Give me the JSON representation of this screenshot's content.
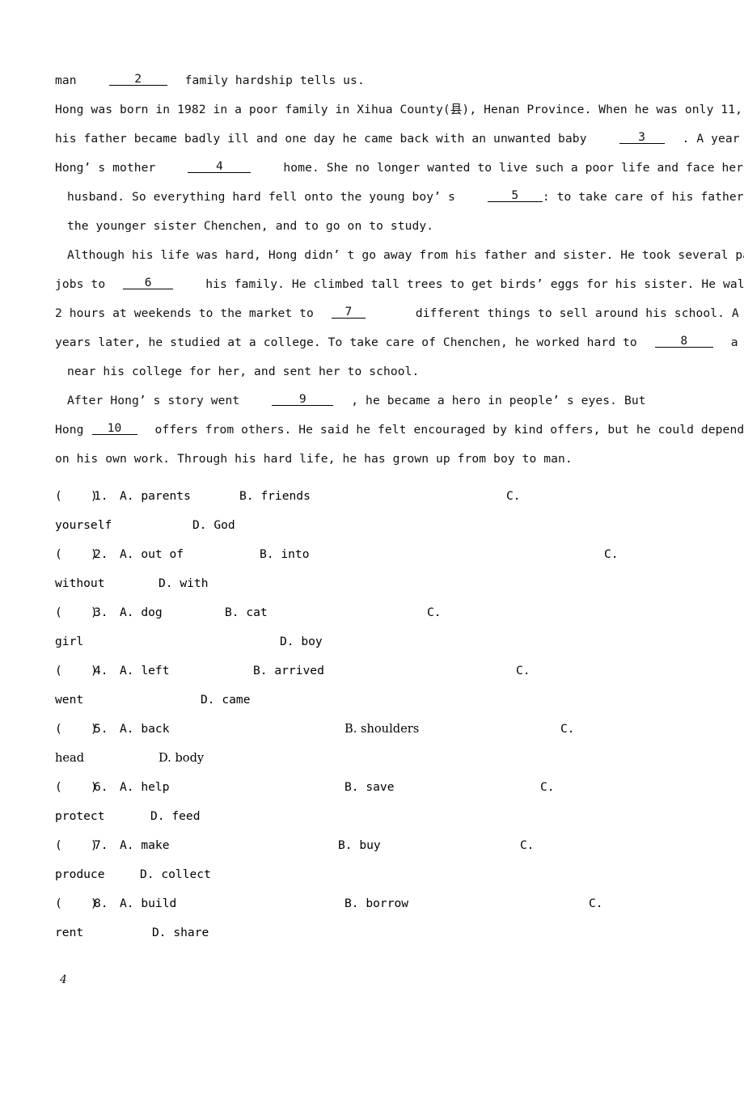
{
  "document": {
    "page_number": "4",
    "language": "en",
    "type": "cloze-test-worksheet"
  },
  "passage": {
    "lines": [
      {
        "id": "l1",
        "segments": [
          "man",
          "blank:2",
          "family hardship tells us."
        ]
      },
      {
        "id": "l2",
        "text": "Hong was born in  1982 in  a poor family in Xihua County(县), Henan Province. When he was only 11,"
      },
      {
        "id": "l3",
        "segments": [
          "his father became badly ill and one day he came back with an unwanted baby",
          "blank:3",
          ". A year later,"
        ]
      },
      {
        "id": "l4",
        "segments": [
          "Hong’ s mother",
          "blank:4",
          "home. She no longer wanted to live such a poor life and face her sick"
        ]
      },
      {
        "id": "l5",
        "segments": [
          "husband. So everything hard fell onto the young boy’ s",
          "blank:5",
          ": to take care of his father and"
        ]
      },
      {
        "id": "l6",
        "text": "the younger sister Chenchen, and to go on to study."
      },
      {
        "id": "l7",
        "text": "Although his life was hard, Hong didn’ t go away from his father and sister. He took several part-time"
      },
      {
        "id": "l8",
        "segments": [
          "jobs to",
          "blank:6",
          "his family. He climbed tall trees to get birds’ eggs for his sister. He walked"
        ]
      },
      {
        "id": "l9",
        "segments": [
          "2 hours at weekends to the market to",
          "blank:7",
          "different things to sell around his school. A few"
        ]
      },
      {
        "id": "l10",
        "segments": [
          "years later, he studied at a college. To take care of Chenchen, he worked hard to",
          "blank:8",
          "a  room"
        ]
      },
      {
        "id": "l11",
        "text": "near his college for her, and sent her to school."
      },
      {
        "id": "l12",
        "segments": [
          "After Hong’ s story went",
          "blank:9",
          ", he became a hero in people’ s eyes. But"
        ]
      },
      {
        "id": "l13",
        "segments": [
          "Hong",
          "blank:10",
          "offers from others. He said he felt encouraged by kind offers, but he could depend"
        ]
      },
      {
        "id": "l14",
        "text": "on his own work. Through his hard life, he has grown up from boy to man."
      }
    ],
    "text_l1_pre": "man",
    "text_l1_post": "family hardship tells us.",
    "text_l2": "Hong was born in  1982 in  a poor family in Xihua County(县), Henan Province. When he was only 11,",
    "text_l3_pre": "his father became badly ill and one day he came back with an unwanted baby",
    "text_l3_post": ". A year later,",
    "text_l4_pre": "Hong’ s mother",
    "text_l4_post": "home. She no longer wanted to live such a poor life and face her sick",
    "text_l5_pre": "husband. So everything hard fell onto the young boy’ s",
    "text_l5_post": ": to take care of his father and",
    "text_l6": "the younger sister Chenchen,  and to go on to study.",
    "text_l7": "Although his life was hard, Hong didn’ t go away from his father and sister. He took several part-time",
    "text_l8_pre": "jobs to",
    "text_l8_post": "his family. He climbed tall trees to get birds’ eggs for his sister. He walked",
    "text_l9_pre": "2 hours at weekends to the market to",
    "text_l9_post": "different things to sell around his school. A few",
    "text_l10_pre": "years later, he studied at a college. To take care of Chenchen, he worked hard to",
    "text_l10_post": "a  room",
    "text_l11": "near his college for her, and sent her to school.",
    "text_l12_pre": "After Hong’ s story went",
    "text_l12_post": ", he became a hero in people’ s eyes. But",
    "text_l13_pre": "Hong",
    "text_l13_post": "offers from others. He said he felt encouraged by kind offers, but he could depend",
    "text_l14": "on his own work. Through his hard life, he has grown up from boy to man."
  },
  "blanks": {
    "n2": "2",
    "n3": "3",
    "n4": "4",
    "n5": "5",
    "n6": "6",
    "n7": "7",
    "n8": "8",
    "n9": "9",
    "n10": "10"
  },
  "questions": [
    {
      "number": "1",
      "bracket": "(    )",
      "num_label": "1.",
      "a": "A. parents",
      "b": "B. friends",
      "c_marker": "C.",
      "c_text": "yourself",
      "d": "D. God"
    },
    {
      "number": "2",
      "bracket": "(    )",
      "num_label": "2.",
      "a": "A. out of",
      "b": "B. into",
      "c_marker": "C.",
      "c_text": "without",
      "d": "D. with"
    },
    {
      "number": "3",
      "bracket": "(    )",
      "num_label": "3.",
      "a": "A. dog",
      "b": "B. cat",
      "c_marker": "C.",
      "c_text": "girl",
      "d": "D. boy"
    },
    {
      "number": "4",
      "bracket": "(    )",
      "num_label": "4.",
      "a": "A. left",
      "b": "B. arrived",
      "c_marker": "C.",
      "c_text": "went",
      "d": "D. came"
    },
    {
      "number": "5",
      "bracket": "(    )",
      "num_label": "5.",
      "a": "A. back",
      "b": "B. shoulders",
      "c_marker": "C.",
      "c_text": "head",
      "d": "D. body"
    },
    {
      "number": "6",
      "bracket": "(    )",
      "num_label": "6.",
      "a": "A. help",
      "b": "B. save",
      "c_marker": "C.",
      "c_text": "protect",
      "d": "D. feed"
    },
    {
      "number": "7",
      "bracket": "(    )",
      "num_label": "7.",
      "a": "A. make",
      "b": "B. buy",
      "c_marker": "C.",
      "c_text": "produce",
      "d": "D. collect"
    },
    {
      "number": "8",
      "bracket": "(    )",
      "num_label": "8.",
      "a": "A. build",
      "b": "B. borrow",
      "c_marker": "C.",
      "c_text": "rent",
      "d": "D. share"
    }
  ]
}
